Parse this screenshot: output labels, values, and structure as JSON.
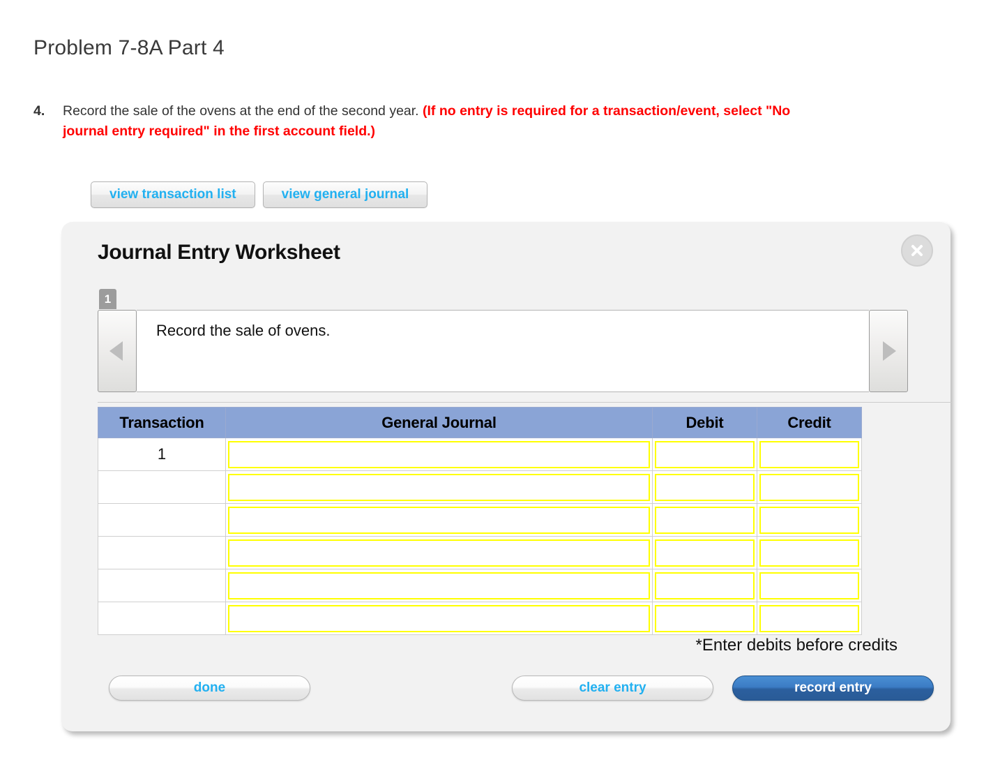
{
  "page_title": "Problem 7-8A Part 4",
  "question": {
    "number": "4.",
    "text": "Record the sale of the ovens at the end of the second year.",
    "note": "(If no entry is required for a transaction/event, select \"No journal entry required\" in the first account field.)"
  },
  "top_buttons": [
    {
      "label": "view transaction list"
    },
    {
      "label": "view general journal"
    }
  ],
  "worksheet": {
    "title": "Journal Entry Worksheet",
    "close_label": "X",
    "step_badge": "1",
    "prompt": "Record the sale of ovens.",
    "prev_arrow": "◀",
    "next_arrow": "▶",
    "table": {
      "headers": [
        "Transaction",
        "General Journal",
        "Debit",
        "Credit"
      ],
      "rows": [
        {
          "transaction": "1",
          "general_journal": "",
          "debit": "",
          "credit": ""
        },
        {
          "transaction": "",
          "general_journal": "",
          "debit": "",
          "credit": ""
        },
        {
          "transaction": "",
          "general_journal": "",
          "debit": "",
          "credit": ""
        },
        {
          "transaction": "",
          "general_journal": "",
          "debit": "",
          "credit": ""
        },
        {
          "transaction": "",
          "general_journal": "",
          "debit": "",
          "credit": ""
        },
        {
          "transaction": "",
          "general_journal": "",
          "debit": "",
          "credit": ""
        }
      ]
    },
    "footnote": "*Enter debits before credits",
    "actions": {
      "done": "done",
      "clear": "clear entry",
      "record": "record entry"
    }
  },
  "colors": {
    "table_header_blue": "#8aa4d6",
    "input_border_yellow": "#ffff00",
    "link_cyan": "#22b0f0",
    "note_red": "#ff0000",
    "record_button_blue": "#2b5f9e",
    "panel_bg": "#f2f2f2"
  }
}
